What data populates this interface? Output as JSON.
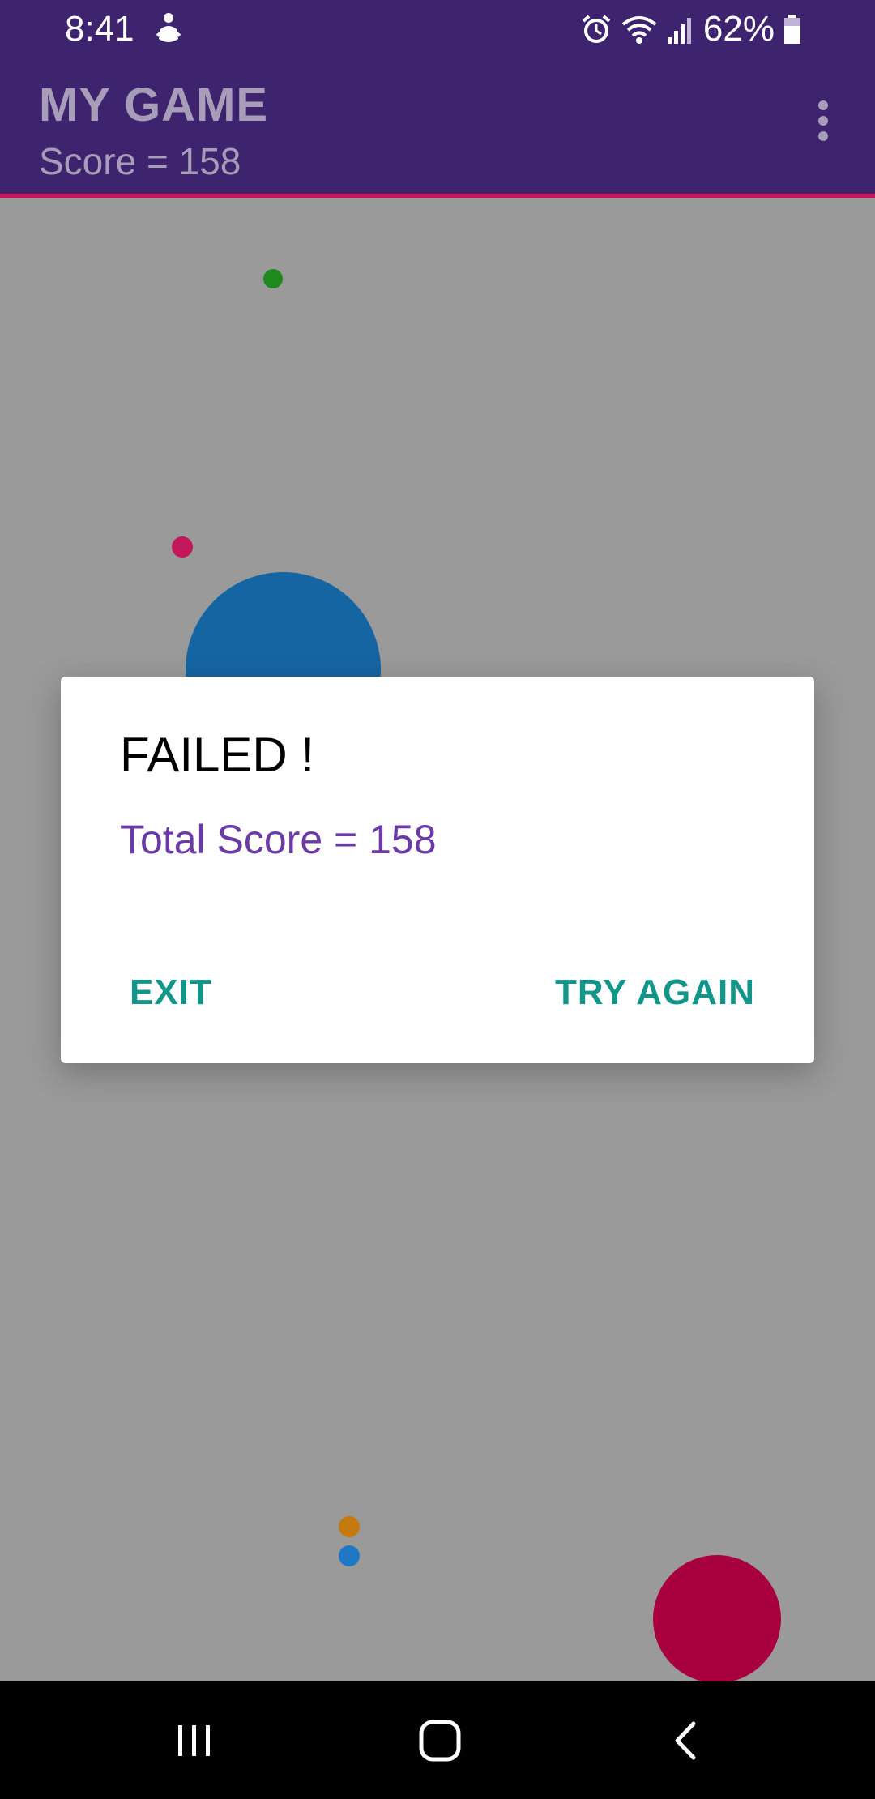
{
  "status_bar": {
    "time": "8:41",
    "battery_percent": "62%",
    "icons": [
      "person-notification-icon",
      "alarm-icon",
      "wifi-icon",
      "signal-icon",
      "battery-icon"
    ]
  },
  "toolbar": {
    "title": "MY GAME",
    "score_text": "Score = 158",
    "menu_icon": "overflow-menu-icon"
  },
  "game": {
    "balls": [
      {
        "color": "#1e8a1e"
      },
      {
        "color": "#c2185b"
      },
      {
        "color": "#1565a3"
      },
      {
        "color": "#c57a10"
      },
      {
        "color": "#1f78c4"
      },
      {
        "color": "#a8003f"
      }
    ]
  },
  "dialog": {
    "title": "FAILED !",
    "message": "Total Score = 158",
    "exit_label": "EXIT",
    "try_again_label": "TRY AGAIN"
  },
  "nav_bar": {
    "icons": [
      "recent-apps-icon",
      "home-icon",
      "back-icon"
    ]
  },
  "colors": {
    "primary": "#3e236e",
    "accent": "#c2185b",
    "button_text": "#12968a",
    "message_text": "#6a3aa6"
  }
}
